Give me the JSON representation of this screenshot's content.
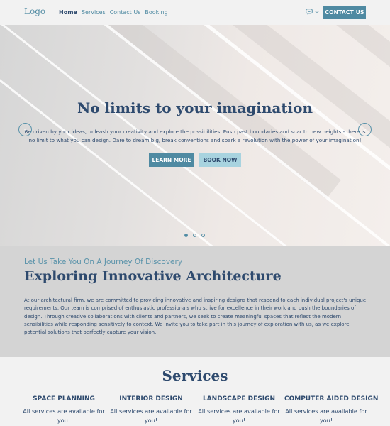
{
  "nav": {
    "logo": "Logo",
    "links": [
      {
        "label": "Home",
        "active": true
      },
      {
        "label": "Services",
        "active": false
      },
      {
        "label": "Contact Us",
        "active": false
      },
      {
        "label": "Booking",
        "active": false
      }
    ],
    "language_icon": "globe-chat-icon",
    "cta_label": "CONTACT US"
  },
  "hero": {
    "title": "No limits to your imagination",
    "text": "Be driven by your ideas, unleash your creativity and explore the possibilities. Push past boundaries and soar to new heights - there is no limit to what you can design. Dare to dream big, break conventions and spark a revolution with the power of your imagination!",
    "prev_icon": "chevron-left-icon",
    "next_icon": "chevron-right-icon",
    "buttons": {
      "primary": "LEARN MORE",
      "secondary": "BOOK NOW"
    },
    "slides_total": 3,
    "active_slide": 1
  },
  "about": {
    "subtitle": "Let Us Take You On A Journey Of Discovery",
    "title": "Exploring Innovative Architecture",
    "text": "At our architectural firm, we are committed to providing innovative and inspiring designs that respond to each individual project's unique requirements. Our team is comprised of enthusiastic professionals who strive for excellence in their work and push the boundaries of design. Through creative collaborations with clients and partners, we seek to create meaningful spaces that reflect the modern sensibilities while responding sensitively to context. We invite you to take part in this journey of exploration with us, as we explore potential solutions that perfectly capture your vision."
  },
  "services": {
    "title": "Services",
    "items": [
      {
        "name": "SPACE PLANNING",
        "description": "All services are available for you!"
      },
      {
        "name": "INTERIOR DESIGN",
        "description": "All services are available for you!"
      },
      {
        "name": "LANDSCAPE DESIGN",
        "description": "All services are available for you!"
      },
      {
        "name": "COMPUTER AIDED DESIGN",
        "description": "All services are available for you!"
      }
    ]
  },
  "colors": {
    "primary": "#4f8aa2",
    "secondary": "#a8d3df",
    "text": "#2e4a6e",
    "band": "#d4d4d4",
    "background": "#f2f2f2"
  }
}
